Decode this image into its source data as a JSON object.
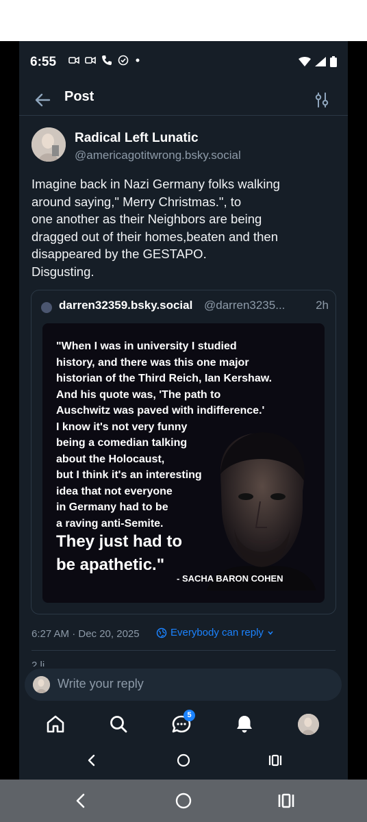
{
  "status_bar": {
    "time": "6:55"
  },
  "header": {
    "title": "Post"
  },
  "post": {
    "author_name": "Radical Left Lunatic",
    "author_handle": "@americagotitwrong.bsky.social",
    "text": "Imagine back in Nazi Germany folks walking\naround saying,\" Merry Christmas.\", to\none another as their Neighbors are being\ndragged out of their homes,beaten and then\ndisappeared by the GESTAPO.\nDisgusting.",
    "timestamp": "6:27 AM · Dec 20, 2025",
    "reply_permission": "Everybody can reply"
  },
  "quote": {
    "username": "darren32359.bsky.social",
    "handle": "@darren3235...",
    "age": "2h",
    "image_lines": [
      "\"When I was in university I studied",
      "history, and there was this one major",
      "historian of the Third Reich, Ian Kershaw.",
      "And his quote was, 'The path to",
      "Auschwitz was paved with indifference.'",
      "I know it's not very funny",
      "being a comedian talking",
      "about the Holocaust,",
      "but I think it's an interesting",
      "idea that not everyone",
      "in Germany had to be",
      "a raving anti-Semite."
    ],
    "image_emphasis_1": "They just had to",
    "image_emphasis_2": "be apathetic.\"",
    "image_attribution": "- SACHA BARON COHEN"
  },
  "likes_peek": "2 li",
  "reply_bar": {
    "placeholder": "Write your reply"
  },
  "bottom_nav": {
    "items": [
      "home-icon",
      "search-icon",
      "chat-icon",
      "notifications-icon",
      "profile-avatar"
    ],
    "chat_badge": "5"
  },
  "colors": {
    "background": "#161e27",
    "accent": "#1b83ff",
    "muted": "#8d9aa8"
  }
}
